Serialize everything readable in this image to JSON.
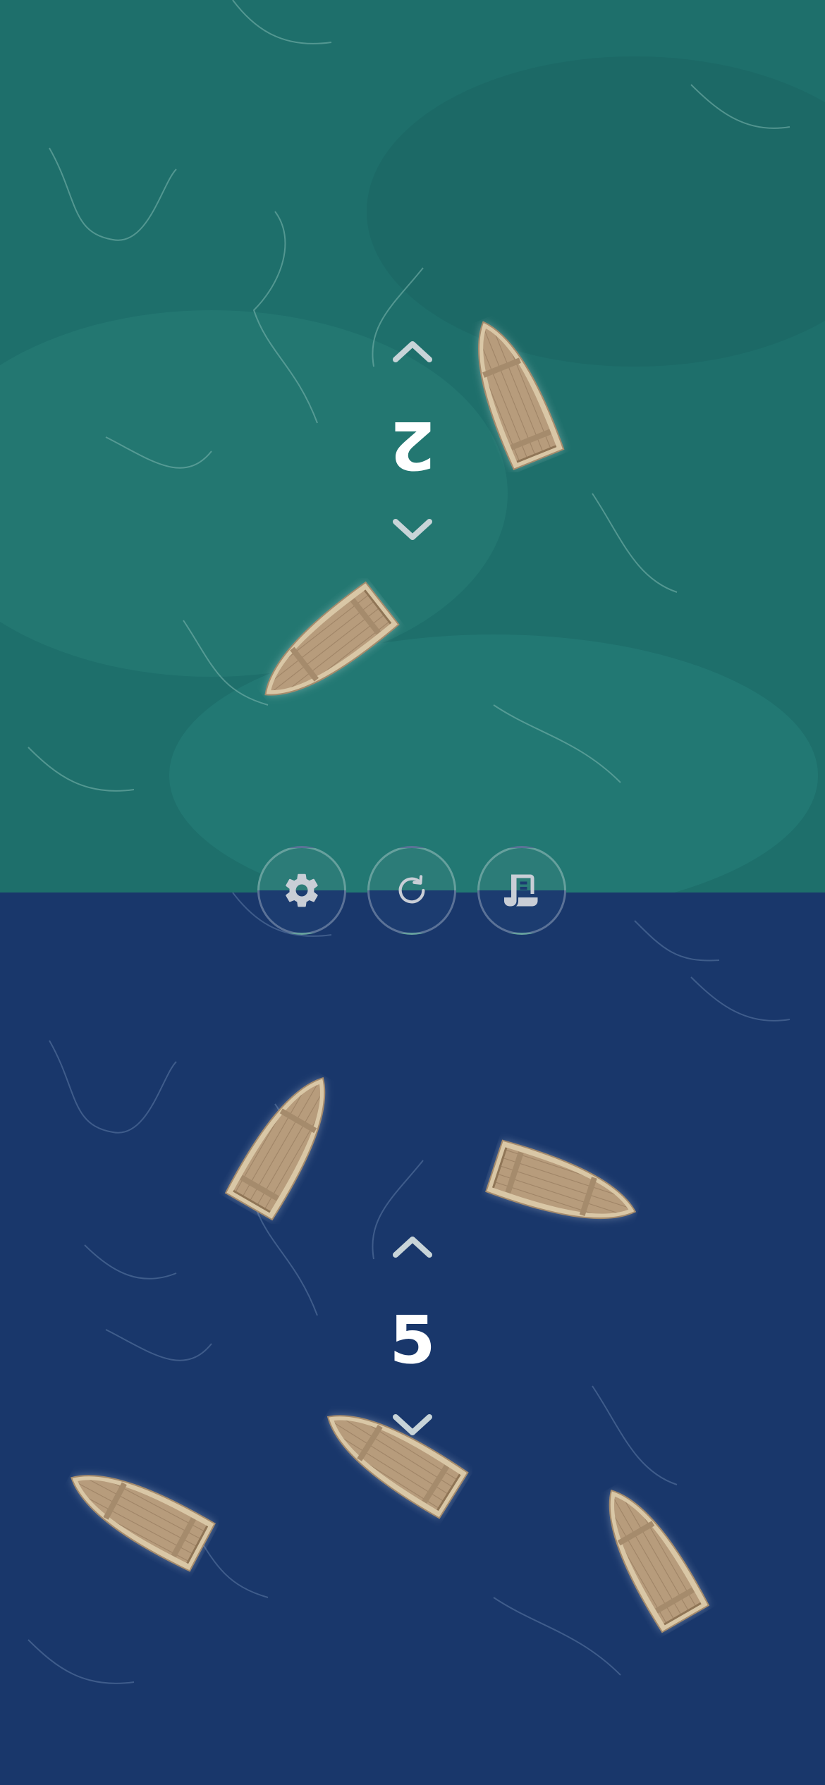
{
  "top_player": {
    "count": "2",
    "water_color": "#1e6f6b",
    "rotated": true
  },
  "bottom_player": {
    "count": "5",
    "water_color": "#19376b"
  },
  "controls": [
    {
      "icon": "gear-icon"
    },
    {
      "icon": "restart-icon"
    },
    {
      "icon": "scroll-icon"
    }
  ],
  "colors": {
    "boat_wood": "#bfa887",
    "boat_rim": "#d8c7a6",
    "arrow": "#c8d4d8"
  }
}
